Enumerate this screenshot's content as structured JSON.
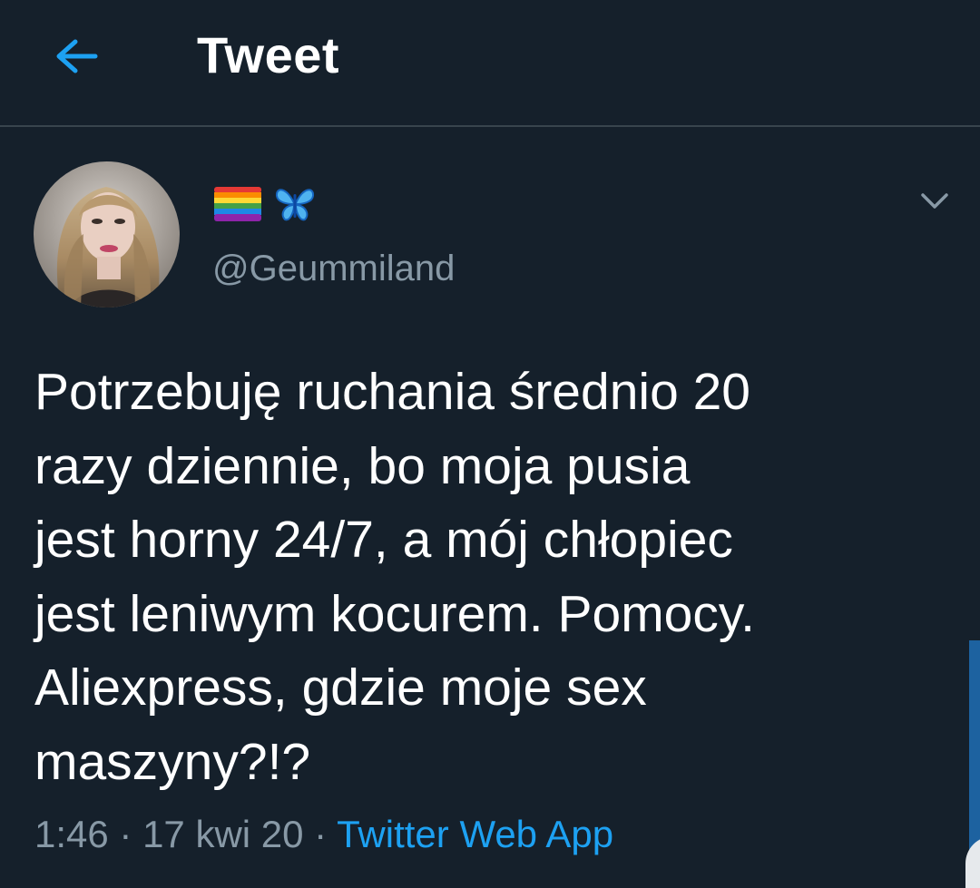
{
  "header": {
    "title": "Tweet",
    "back_icon": "arrow-left-icon",
    "accent": "#1da1f2"
  },
  "author": {
    "display_name_icons": [
      "rainbow-flag-icon",
      "butterfly-icon"
    ],
    "username": "@Geummiland"
  },
  "tweet": {
    "lines": [
      "Potrzebuję ruchania średnio 20",
      "razy dziennie, bo moja pusia",
      "jest horny 24/7, a mój chłopiec",
      "jest leniwym kocurem. Pomocy.",
      "Aliexpress, gdzie moje sex",
      "maszyny?!?"
    ]
  },
  "meta": {
    "time": "1:46",
    "separator": " · ",
    "date": "17 kwi 20",
    "source": "Twitter Web App"
  },
  "colors": {
    "background": "#15202b",
    "muted_text": "#8899a6",
    "divider": "#38444d",
    "link": "#1da1f2"
  }
}
